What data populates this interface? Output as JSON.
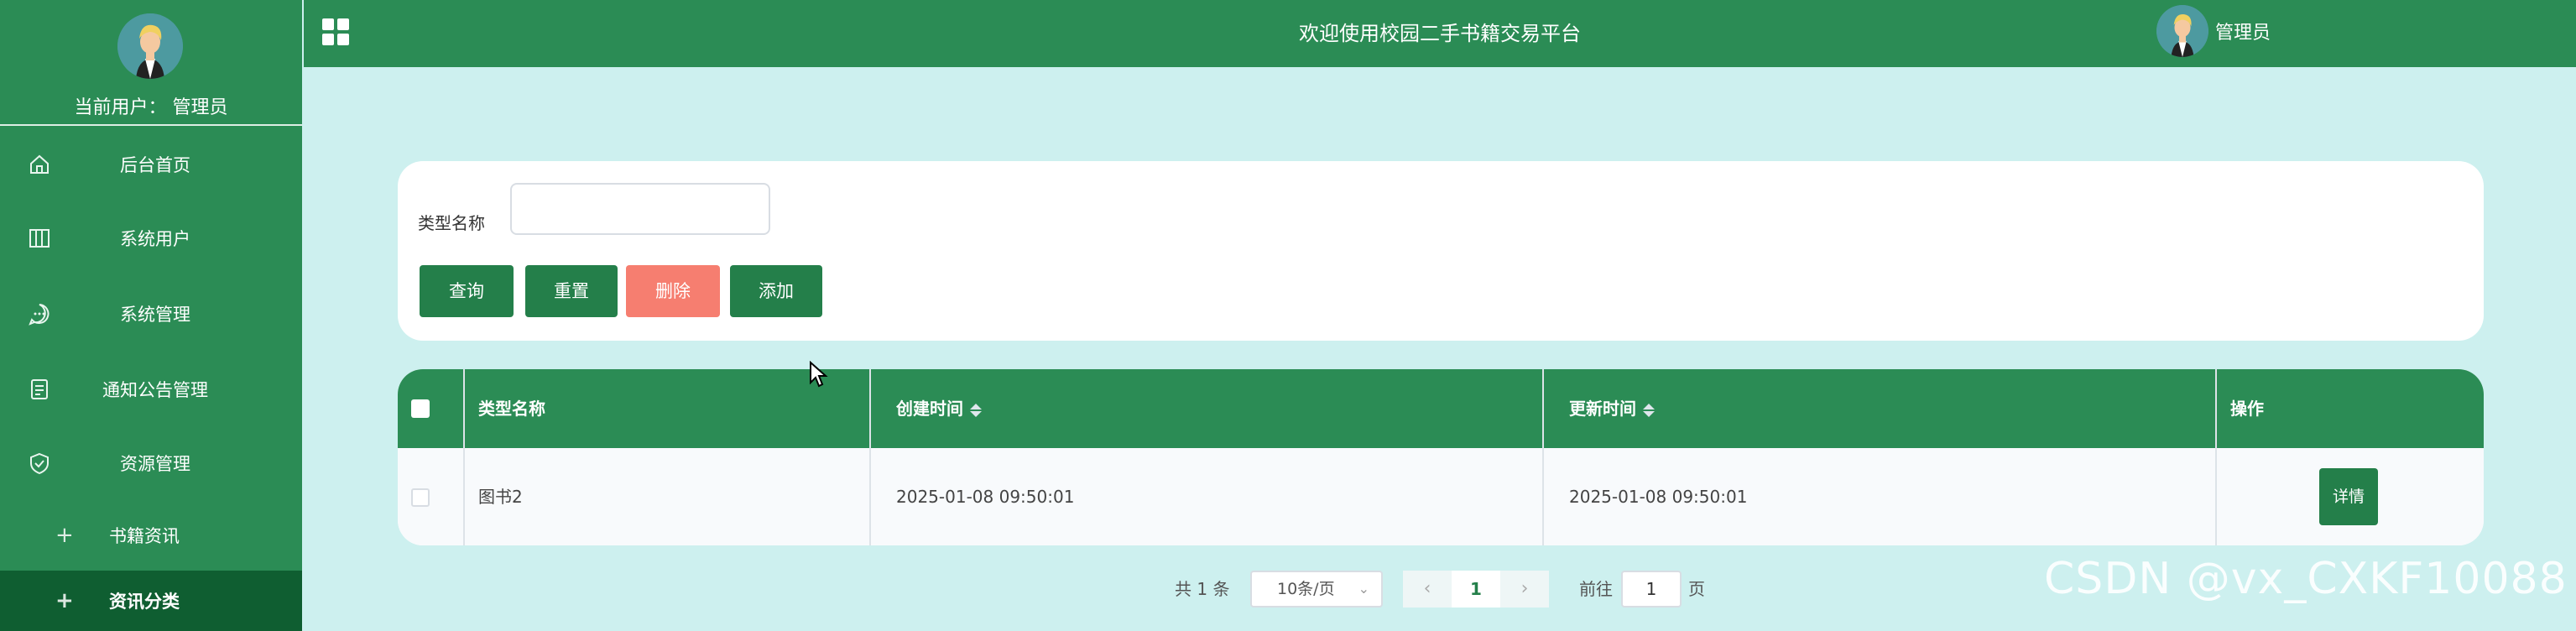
{
  "sidebar": {
    "current_user": "当前用户： 管理员",
    "items": [
      {
        "label": "后台首页",
        "icon": "home-icon"
      },
      {
        "label": "系统用户",
        "icon": "columns-icon"
      },
      {
        "label": "系统管理",
        "icon": "chat-icon"
      },
      {
        "label": "通知公告管理",
        "icon": "document-icon"
      },
      {
        "label": "资源管理",
        "icon": "shield-check-icon"
      }
    ],
    "sub_items": [
      {
        "label": "书籍资讯",
        "icon": "plus-icon",
        "active": false
      },
      {
        "label": "资讯分类",
        "icon": "plus-icon",
        "active": true
      }
    ]
  },
  "topbar": {
    "title": "欢迎使用校园二手书籍交易平台",
    "user": "管理员",
    "menu_icon": "grid-icon"
  },
  "search": {
    "label": "类型名称",
    "value": "",
    "buttons": {
      "query": "查询",
      "reset": "重置",
      "delete": "删除",
      "add": "添加"
    }
  },
  "table": {
    "columns": [
      "类型名称",
      "创建时间",
      "更新时间",
      "操作"
    ],
    "rows": [
      {
        "name": "图书2",
        "created": "2025-01-08 09:50:01",
        "updated": "2025-01-08 09:50:01",
        "action": "详情"
      }
    ]
  },
  "pagination": {
    "total": "共 1 条",
    "page_size": "10条/页",
    "current_page": "1",
    "goto_label": "前往",
    "goto_value": "1",
    "page_suffix": "页"
  },
  "watermark": "CSDN @vx_CXKF10088",
  "colors": {
    "primary": "#2b8c55",
    "sidebar_active": "#0f5e31",
    "background": "#cdf0ef",
    "danger": "#f67e70"
  }
}
